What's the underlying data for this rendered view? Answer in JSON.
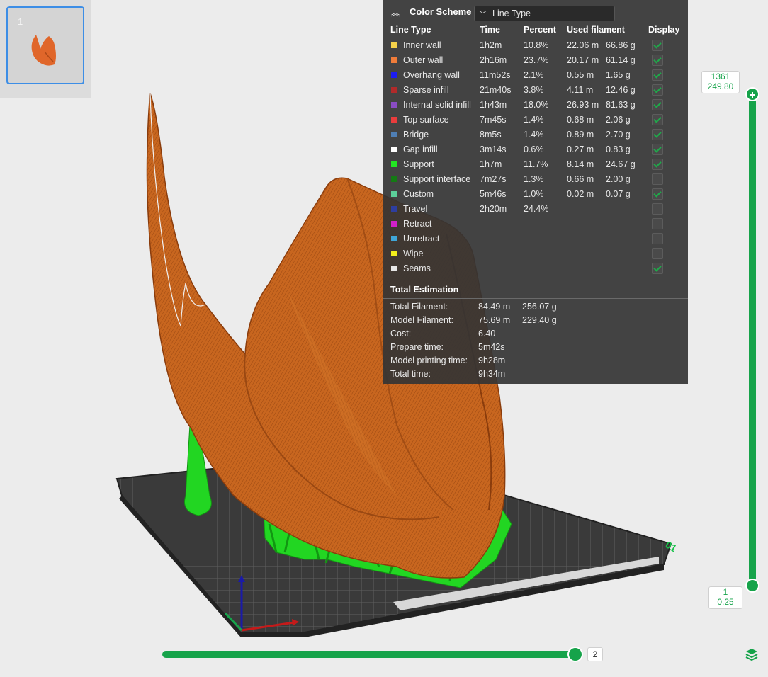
{
  "thumbnail": {
    "plate_number": "1"
  },
  "color_scheme": {
    "title": "Color Scheme",
    "selected": "Line Type",
    "collapse_icon": "double-chevron-up-icon",
    "dropdown_icon": "chevron-down-icon"
  },
  "columns": [
    "Line Type",
    "Time",
    "Percent",
    "Used filament",
    "Display"
  ],
  "rows": [
    {
      "name": "Inner wall",
      "color": "#f5d24a",
      "time": "1h2m",
      "percent": "10.8%",
      "length": "22.06 m",
      "weight": "66.86 g",
      "display": true
    },
    {
      "name": "Outer wall",
      "color": "#f07c3a",
      "time": "2h16m",
      "percent": "23.7%",
      "length": "20.17 m",
      "weight": "61.14 g",
      "display": true
    },
    {
      "name": "Overhang wall",
      "color": "#1c1cf2",
      "time": "11m52s",
      "percent": "2.1%",
      "length": "0.55 m",
      "weight": "1.65 g",
      "display": true
    },
    {
      "name": "Sparse infill",
      "color": "#b02a2a",
      "time": "21m40s",
      "percent": "3.8%",
      "length": "4.11 m",
      "weight": "12.46 g",
      "display": true
    },
    {
      "name": "Internal solid infill",
      "color": "#8a4cc4",
      "time": "1h43m",
      "percent": "18.0%",
      "length": "26.93 m",
      "weight": "81.63 g",
      "display": true
    },
    {
      "name": "Top surface",
      "color": "#e83c3c",
      "time": "7m45s",
      "percent": "1.4%",
      "length": "0.68 m",
      "weight": "2.06 g",
      "display": true
    },
    {
      "name": "Bridge",
      "color": "#4f7fb5",
      "time": "8m5s",
      "percent": "1.4%",
      "length": "0.89 m",
      "weight": "2.70 g",
      "display": true
    },
    {
      "name": "Gap infill",
      "color": "#ffffff",
      "time": "3m14s",
      "percent": "0.6%",
      "length": "0.27 m",
      "weight": "0.83 g",
      "display": true
    },
    {
      "name": "Support",
      "color": "#22e622",
      "time": "1h7m",
      "percent": "11.7%",
      "length": "8.14 m",
      "weight": "24.67 g",
      "display": true
    },
    {
      "name": "Support interface",
      "color": "#147a14",
      "time": "7m27s",
      "percent": "1.3%",
      "length": "0.66 m",
      "weight": "2.00 g",
      "display": false
    },
    {
      "name": "Custom",
      "color": "#5ccf9a",
      "time": "5m46s",
      "percent": "1.0%",
      "length": "0.02 m",
      "weight": "0.07 g",
      "display": true
    },
    {
      "name": "Travel",
      "color": "#2e3ea0",
      "time": "2h20m",
      "percent": "24.4%",
      "length": "",
      "weight": "",
      "display": false
    },
    {
      "name": "Retract",
      "color": "#d120c9",
      "time": "",
      "percent": "",
      "length": "",
      "weight": "",
      "display": false
    },
    {
      "name": "Unretract",
      "color": "#3fa6d8",
      "time": "",
      "percent": "",
      "length": "",
      "weight": "",
      "display": false
    },
    {
      "name": "Wipe",
      "color": "#f2ee1c",
      "time": "",
      "percent": "",
      "length": "",
      "weight": "",
      "display": false
    },
    {
      "name": "Seams",
      "color": "#e6e6e6",
      "time": "",
      "percent": "",
      "length": "",
      "weight": "",
      "display": true
    }
  ],
  "total_estimation": {
    "title": "Total Estimation",
    "items": [
      {
        "label": "Total Filament:",
        "value": "84.49 m",
        "value2": "256.07 g"
      },
      {
        "label": "Model Filament:",
        "value": "75.69 m",
        "value2": "229.40 g"
      },
      {
        "label": "Cost:",
        "value": "6.40",
        "value2": ""
      },
      {
        "label": "Prepare time:",
        "value": "5m42s",
        "value2": ""
      },
      {
        "label": "Model printing time:",
        "value": "9h28m",
        "value2": ""
      },
      {
        "label": "Total time:",
        "value": "9h34m",
        "value2": ""
      }
    ]
  },
  "layer_slider": {
    "top_layer": "1361",
    "top_height": "249.80",
    "bottom_layer": "1",
    "bottom_height": "0.25"
  },
  "move_slider": {
    "value": "2"
  },
  "bed": {
    "plate_label": "01"
  },
  "icons": {
    "layers": "layers-icon",
    "add": "plus-icon"
  }
}
